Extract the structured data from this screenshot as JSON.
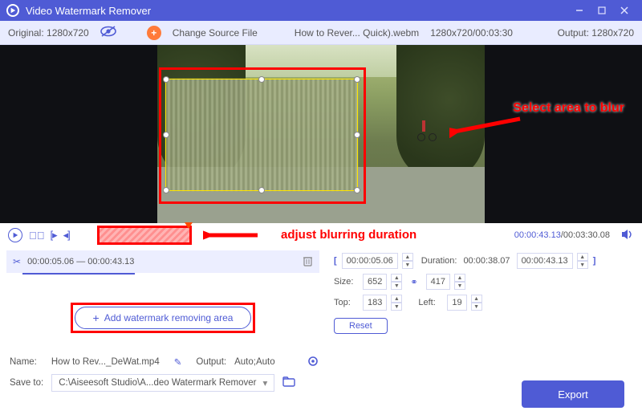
{
  "titlebar": {
    "title": "Video Watermark Remover"
  },
  "infobar": {
    "original_label": "Original: 1280x720",
    "change_source": "Change Source File",
    "filename": "How to Rever... Quick).webm",
    "res_dur": "1280x720/00:03:30",
    "output_label": "Output: 1280x720"
  },
  "annotations": {
    "select_area": "Select area to blur",
    "adjust_duration": "adjust blurring duration"
  },
  "controls": {
    "time_current": "00:00:43.13",
    "time_total": "/00:03:30.08"
  },
  "segment": {
    "range_text": "00:00:05.06 — 00:00:43.13"
  },
  "params": {
    "in_time": "00:00:05.06",
    "dur_label": "Duration:",
    "dur_val": "00:00:38.07",
    "out_time": "00:00:43.13",
    "size_label": "Size:",
    "size_w": "652",
    "size_h": "417",
    "top_label": "Top:",
    "top_val": "183",
    "left_label": "Left:",
    "left_val": "19",
    "reset": "Reset"
  },
  "add_area": {
    "label": "Add watermark removing area"
  },
  "footer": {
    "name_label": "Name:",
    "name_value": "How to Rev..._DeWat.mp4",
    "output_label": "Output:",
    "output_value": "Auto;Auto",
    "save_label": "Save to:",
    "save_value": "C:\\Aiseesoft Studio\\A...deo Watermark Remover",
    "export": "Export"
  }
}
